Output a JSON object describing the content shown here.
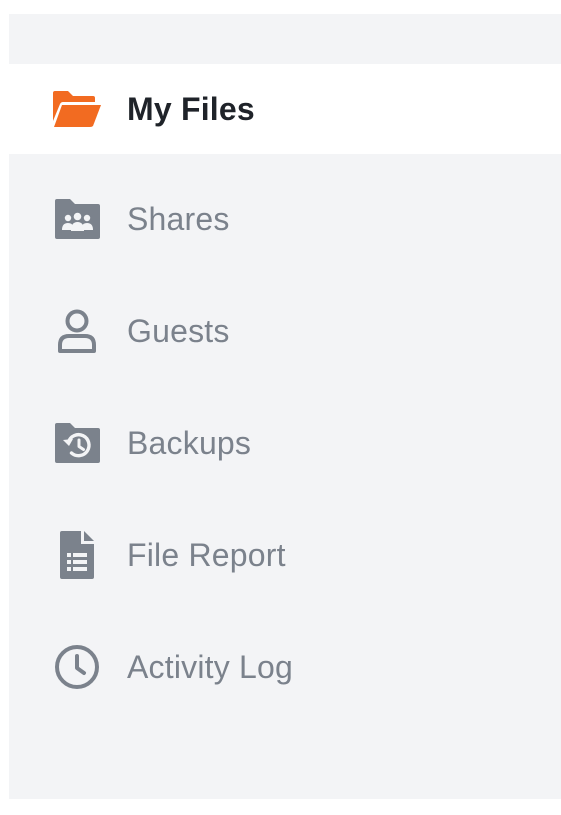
{
  "colors": {
    "background": "#f3f4f6",
    "active_background": "#ffffff",
    "active_icon": "#f26b21",
    "active_text": "#1f2329",
    "inactive": "#7b828c"
  },
  "nav": {
    "items": [
      {
        "label": "My Files",
        "icon": "folder-open-icon",
        "active": true
      },
      {
        "label": "Shares",
        "icon": "shared-folder-icon",
        "active": false
      },
      {
        "label": "Guests",
        "icon": "user-icon",
        "active": false
      },
      {
        "label": "Backups",
        "icon": "backup-folder-icon",
        "active": false
      },
      {
        "label": "File Report",
        "icon": "file-report-icon",
        "active": false
      },
      {
        "label": "Activity Log",
        "icon": "clock-icon",
        "active": false
      }
    ]
  }
}
